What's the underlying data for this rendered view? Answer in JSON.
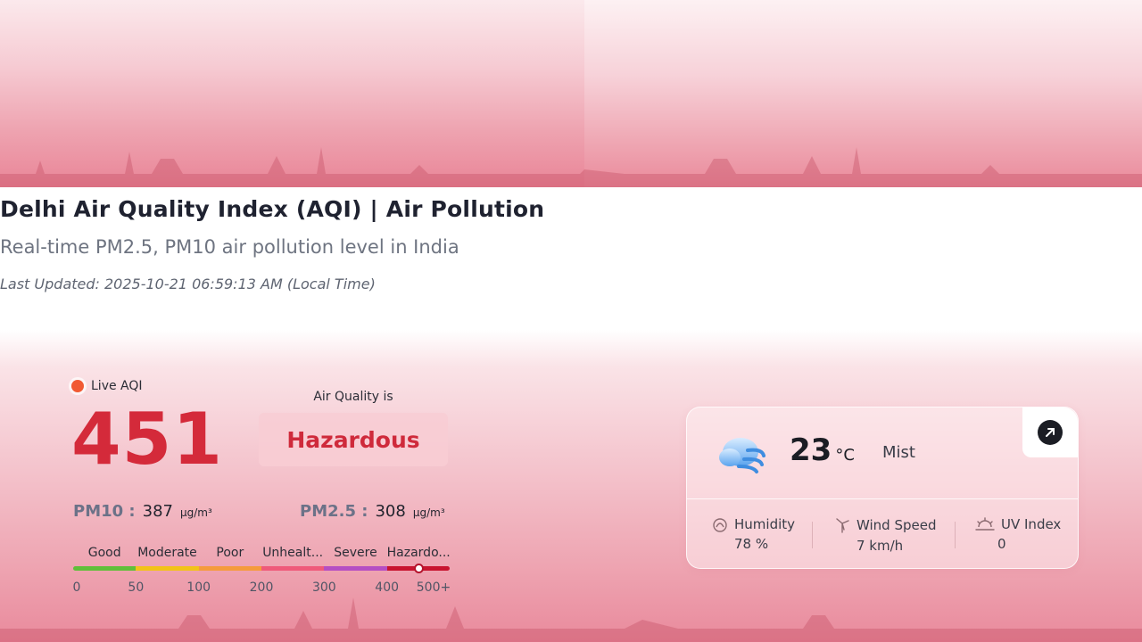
{
  "header": {
    "title": "Delhi Air Quality Index (AQI) | Air Pollution",
    "subtitle": "Real-time PM2.5, PM10 air pollution level in India",
    "last_updated": "Last Updated: 2025-10-21 06:59:13 AM (Local Time)"
  },
  "aqi": {
    "live_label": "Live AQI",
    "value": "451",
    "status_caption": "Air Quality is",
    "status": "Hazardous",
    "status_color": "#cf2a3b",
    "value_color": "#d42a3a",
    "pm10": {
      "label": "PM10 :",
      "value": "387",
      "unit": "µg/m³"
    },
    "pm25": {
      "label": "PM2.5 :",
      "value": "308",
      "unit": "µg/m³"
    },
    "scale": {
      "categories": [
        "Good",
        "Moderate",
        "Poor",
        "Unhealt...",
        "Severe",
        "Hazardo..."
      ],
      "colors": [
        "#5fbf3a",
        "#f2c318",
        "#f59b3c",
        "#ef5a7a",
        "#b54ec3",
        "#c8142f"
      ],
      "ticks": [
        "0",
        "50",
        "100",
        "200",
        "300",
        "400",
        "500+"
      ],
      "current_value": 451
    }
  },
  "weather": {
    "icon": "cloud-wind-icon",
    "temperature": "23",
    "temperature_unit": "°C",
    "condition": "Mist",
    "stats": [
      {
        "label": "Humidity",
        "value": "78 %",
        "icon": "humidity-icon"
      },
      {
        "label": "Wind Speed",
        "value": "7 km/h",
        "icon": "wind-icon"
      },
      {
        "label": "UV Index",
        "value": "0",
        "icon": "uv-icon"
      }
    ]
  }
}
